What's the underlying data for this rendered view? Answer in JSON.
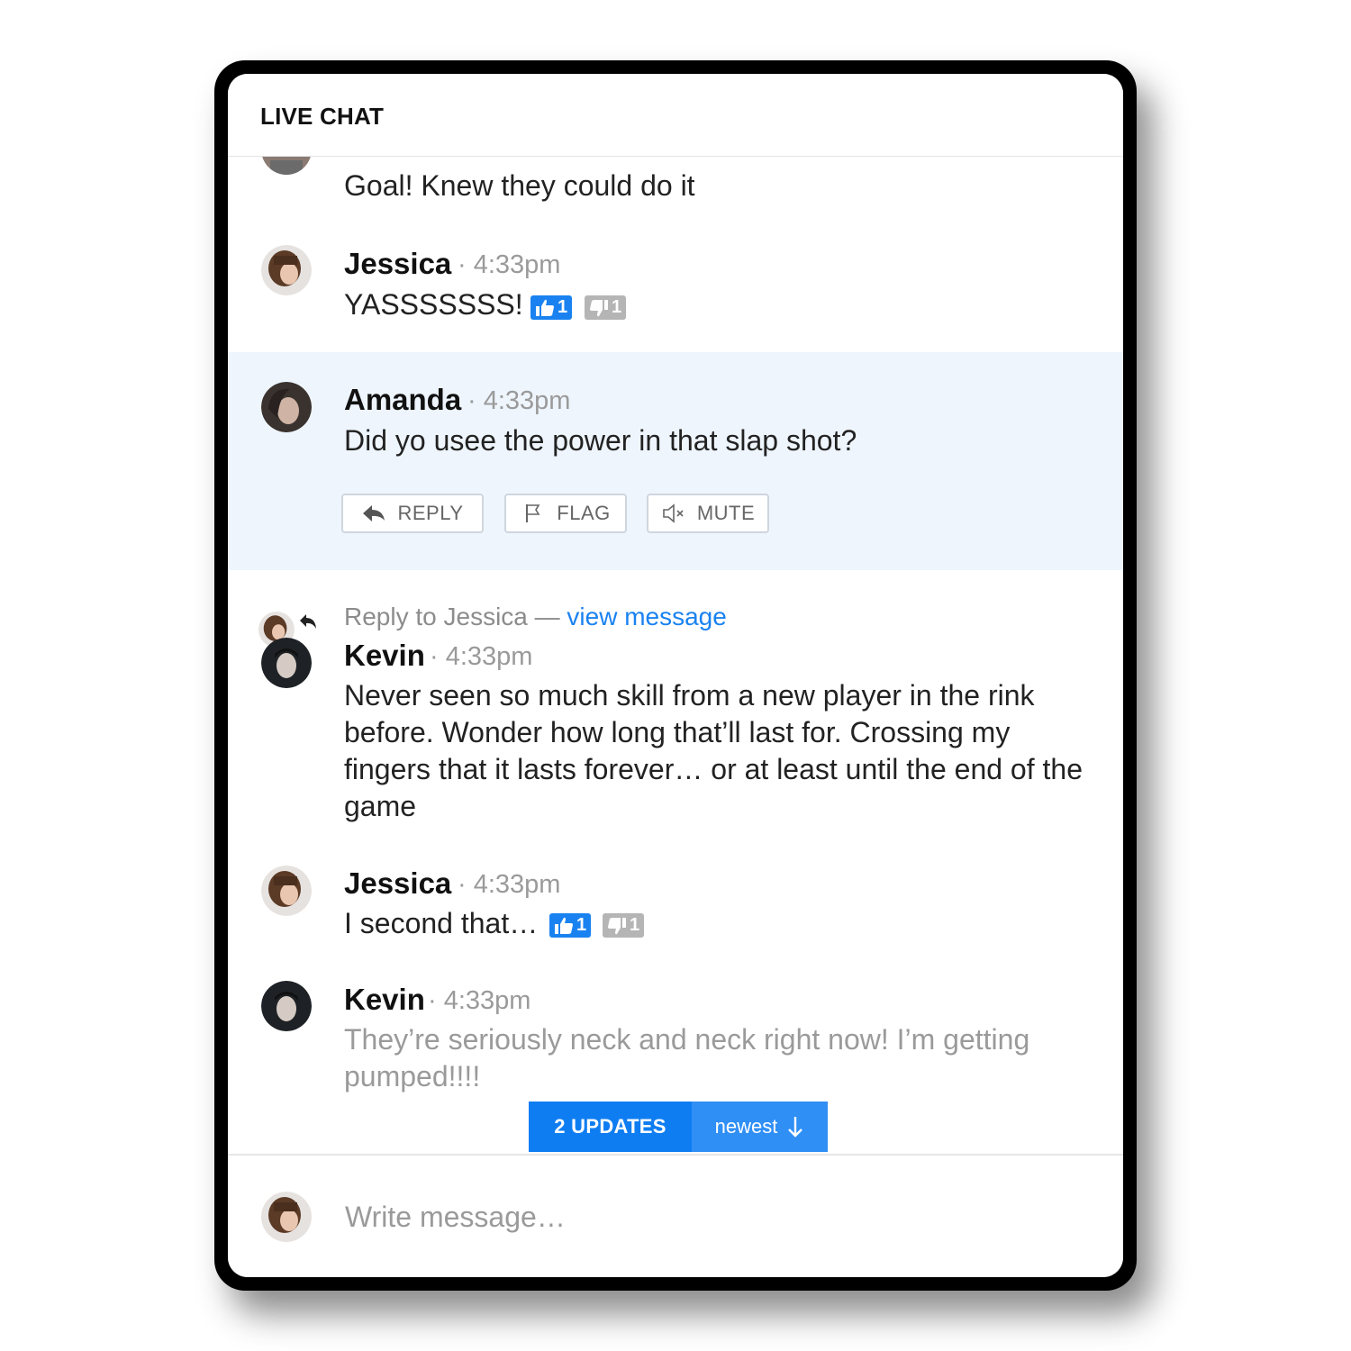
{
  "header": {
    "title": "LIVE CHAT"
  },
  "messages": [
    {
      "text": "Goal! Knew they could do it"
    },
    {
      "author": "Jessica",
      "time": "4:33pm",
      "text": "YASSSSSSS!",
      "likes": "1",
      "dislikes": "1"
    },
    {
      "author": "Amanda",
      "time": "4:33pm",
      "text": "Did yo usee the power in that slap shot?",
      "actions": {
        "reply": "REPLY",
        "flag": "FLAG",
        "mute": "MUTE"
      }
    },
    {
      "reply_prefix": "Reply to Jessica —",
      "reply_link": "view message",
      "author": "Kevin",
      "time": "4:33pm",
      "text": "Never seen so much skill from a new player in the rink before. Wonder how long that’ll last for. Crossing my fingers that it lasts forever… or at least until the end of the game"
    },
    {
      "author": "Jessica",
      "time": "4:33pm",
      "text": "I second that…",
      "likes": "1",
      "dislikes": "1"
    },
    {
      "author": "Kevin",
      "time": "4:33pm",
      "text": "They’re seriously neck and neck right now! I’m getting pumped!!!!"
    }
  ],
  "updates": {
    "count_label": "2 UPDATES",
    "newest_label": "newest"
  },
  "composer": {
    "placeholder": "Write message…"
  },
  "colors": {
    "accent": "#1a82f0",
    "highlight": "#eef5fd"
  },
  "icons": [
    "thumbs-up-icon",
    "thumbs-down-icon",
    "reply-arrow-icon",
    "flag-icon",
    "mute-icon",
    "arrow-down-icon"
  ]
}
